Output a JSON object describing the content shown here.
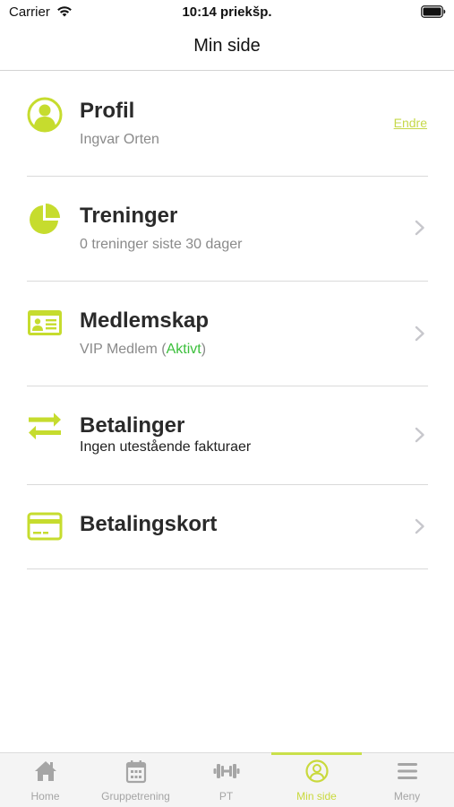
{
  "status_bar": {
    "carrier": "Carrier",
    "time": "10:14 priekšp."
  },
  "nav": {
    "title": "Min side"
  },
  "colors": {
    "accent": "#c6dc2e",
    "active_status": "#3bbf3b",
    "tab_inactive": "#a5a5a5"
  },
  "rows": {
    "profile": {
      "icon": "user-avatar-icon",
      "title": "Profil",
      "subtitle": "Ingvar Orten",
      "action": "Endre"
    },
    "trainings": {
      "icon": "pie-chart-icon",
      "title": "Treninger",
      "subtitle": "0 treninger siste 30 dager"
    },
    "membership": {
      "icon": "id-card-icon",
      "title": "Medlemskap",
      "subtitle_prefix": "VIP Medlem (",
      "status": "Aktivt",
      "subtitle_suffix": ")"
    },
    "payments": {
      "icon": "swap-arrows-icon",
      "title": "Betalinger",
      "subtitle": "Ingen utestående fakturaer"
    },
    "card": {
      "icon": "credit-card-icon",
      "title": "Betalingskort"
    }
  },
  "tabs": [
    {
      "label": "Home",
      "icon": "home-icon",
      "active": false
    },
    {
      "label": "Gruppetrening",
      "icon": "calendar-icon",
      "active": false
    },
    {
      "label": "PT",
      "icon": "dumbbell-icon",
      "active": false
    },
    {
      "label": "Min side",
      "icon": "user-circle-icon",
      "active": true
    },
    {
      "label": "Meny",
      "icon": "menu-icon",
      "active": false
    }
  ]
}
